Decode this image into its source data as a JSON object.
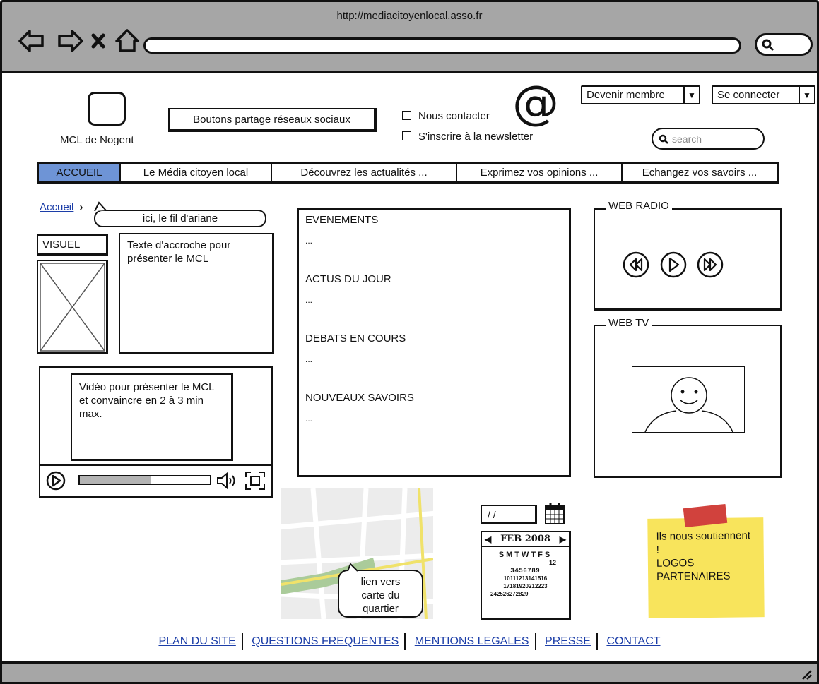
{
  "browser": {
    "url": "http://mediacitoyenlocal.asso.fr"
  },
  "header": {
    "logo_label": "MCL de Nogent",
    "social_share_label": "Boutons partage réseaux sociaux",
    "contact_label": "Nous contacter",
    "newsletter_label": "S'inscrire à la newsletter",
    "at_symbol": "@",
    "become_member_label": "Devenir membre",
    "login_label": "Se connecter",
    "search_placeholder": "search"
  },
  "nav": {
    "tabs": [
      {
        "label": "ACCUEIL",
        "active": true
      },
      {
        "label": "Le Média citoyen local"
      },
      {
        "label": "Découvrez les actualités ..."
      },
      {
        "label": "Exprimez vos opinions ..."
      },
      {
        "label": "Echangez vos savoirs ..."
      }
    ]
  },
  "breadcrumb": {
    "home": "Accueil",
    "separator": "›",
    "callout": "ici, le fil d'ariane"
  },
  "left": {
    "visual_label": "VISUEL",
    "intro_text": "Texte d'accroche pour présenter le MCL",
    "video_text": "Vidéo pour présenter le MCL\net convaincre en 2 à 3 min max.",
    "video_progress": 0.55
  },
  "center": {
    "sections": [
      {
        "title": "EVENEMENTS",
        "body": "..."
      },
      {
        "title": "ACTUS DU JOUR",
        "body": "..."
      },
      {
        "title": "DEBATS EN COURS",
        "body": "..."
      },
      {
        "title": "NOUVEAUX SAVOIRS",
        "body": "..."
      }
    ]
  },
  "right": {
    "radio_title": "WEB RADIO",
    "tv_title": "WEB TV"
  },
  "widgets": {
    "map_callout": "lien vers\ncarte du\nquartier",
    "date_input": "/ /",
    "calendar": {
      "month": "FEB 2008",
      "weekdays": "SMTWTFS",
      "rows": [
        "12",
        "3456789",
        "10111213141516",
        "17181920212223",
        "242526272829"
      ]
    },
    "sticky_text": "Ils nous soutiennent !\nLOGOS PARTENAIRES",
    "sticky_color": "#f8e45c",
    "tape_color": "#d1423d"
  },
  "footer": {
    "links": [
      "PLAN DU SITE",
      "QUESTIONS FREQUENTES",
      "MENTIONS LEGALES",
      "PRESSE",
      "CONTACT"
    ]
  }
}
